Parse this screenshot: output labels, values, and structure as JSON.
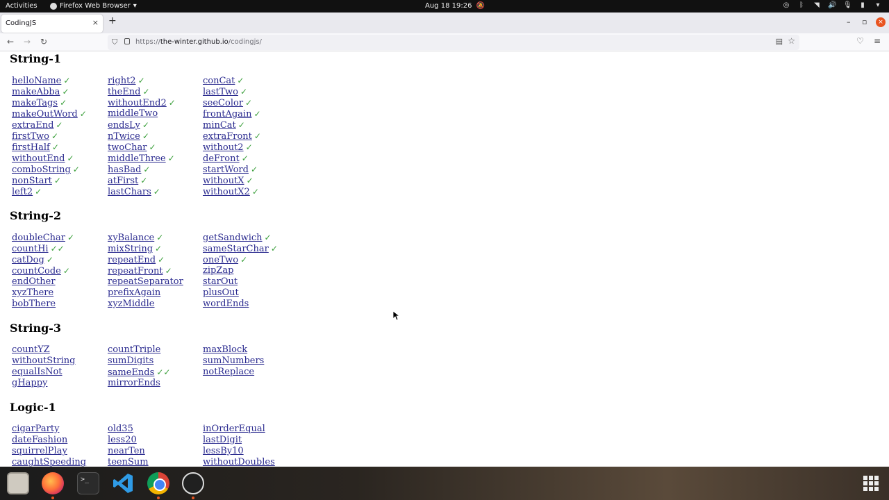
{
  "topbar": {
    "activities": "Activities",
    "app_name": "Firefox Web Browser",
    "clock": "Aug 18  19:26"
  },
  "browser": {
    "tab_title": "CodingJS",
    "url_host_prefix": "https://",
    "url_host": "the-winter.github.io",
    "url_path": "/codingjs/"
  },
  "sections": [
    {
      "title": "String-1",
      "columns": [
        [
          {
            "name": "helloName",
            "check": "✓"
          },
          {
            "name": "makeAbba",
            "check": "✓"
          },
          {
            "name": "makeTags",
            "check": "✓"
          },
          {
            "name": "makeOutWord",
            "check": "✓"
          },
          {
            "name": "extraEnd",
            "check": "✓"
          },
          {
            "name": "firstTwo",
            "check": "✓"
          },
          {
            "name": "firstHalf",
            "check": "✓"
          },
          {
            "name": "withoutEnd",
            "check": "✓"
          },
          {
            "name": "comboString",
            "check": "✓"
          },
          {
            "name": "nonStart",
            "check": "✓"
          },
          {
            "name": "left2",
            "check": "✓"
          }
        ],
        [
          {
            "name": "right2",
            "check": "✓"
          },
          {
            "name": "theEnd",
            "check": "✓"
          },
          {
            "name": "withoutEnd2",
            "check": "✓"
          },
          {
            "name": "middleTwo",
            "check": ""
          },
          {
            "name": "endsLy",
            "check": "✓"
          },
          {
            "name": "nTwice",
            "check": "✓"
          },
          {
            "name": "twoChar",
            "check": "✓"
          },
          {
            "name": "middleThree",
            "check": "✓"
          },
          {
            "name": "hasBad",
            "check": "✓"
          },
          {
            "name": "atFirst",
            "check": "✓"
          },
          {
            "name": "lastChars",
            "check": "✓"
          }
        ],
        [
          {
            "name": "conCat",
            "check": "✓"
          },
          {
            "name": "lastTwo",
            "check": "✓"
          },
          {
            "name": "seeColor",
            "check": "✓"
          },
          {
            "name": "frontAgain",
            "check": "✓"
          },
          {
            "name": "minCat",
            "check": "✓"
          },
          {
            "name": "extraFront",
            "check": "✓"
          },
          {
            "name": "without2",
            "check": "✓"
          },
          {
            "name": "deFront",
            "check": "✓"
          },
          {
            "name": "startWord",
            "check": "✓"
          },
          {
            "name": "withoutX",
            "check": "✓"
          },
          {
            "name": "withoutX2",
            "check": "✓"
          }
        ]
      ]
    },
    {
      "title": "String-2",
      "columns": [
        [
          {
            "name": "doubleChar",
            "check": "✓"
          },
          {
            "name": "countHi",
            "check": "✓✓"
          },
          {
            "name": "catDog",
            "check": "✓"
          },
          {
            "name": "countCode",
            "check": "✓"
          },
          {
            "name": "endOther",
            "check": ""
          },
          {
            "name": "xyzThere",
            "check": ""
          },
          {
            "name": "bobThere",
            "check": ""
          }
        ],
        [
          {
            "name": "xyBalance",
            "check": "✓"
          },
          {
            "name": "mixString",
            "check": "✓"
          },
          {
            "name": "repeatEnd",
            "check": "✓"
          },
          {
            "name": "repeatFront",
            "check": "✓"
          },
          {
            "name": "repeatSeparator",
            "check": ""
          },
          {
            "name": "prefixAgain",
            "check": ""
          },
          {
            "name": "xyzMiddle",
            "check": ""
          }
        ],
        [
          {
            "name": "getSandwich",
            "check": "✓"
          },
          {
            "name": "sameStarChar",
            "check": "✓"
          },
          {
            "name": "oneTwo",
            "check": "✓"
          },
          {
            "name": "zipZap",
            "check": ""
          },
          {
            "name": "starOut",
            "check": ""
          },
          {
            "name": "plusOut",
            "check": ""
          },
          {
            "name": "wordEnds",
            "check": ""
          }
        ]
      ]
    },
    {
      "title": "String-3",
      "columns": [
        [
          {
            "name": "countYZ",
            "check": ""
          },
          {
            "name": "withoutString",
            "check": ""
          },
          {
            "name": "equalIsNot",
            "check": ""
          },
          {
            "name": "gHappy",
            "check": ""
          }
        ],
        [
          {
            "name": "countTriple",
            "check": ""
          },
          {
            "name": "sumDigits",
            "check": ""
          },
          {
            "name": "sameEnds",
            "check": "✓✓"
          },
          {
            "name": "mirrorEnds",
            "check": ""
          }
        ],
        [
          {
            "name": "maxBlock",
            "check": ""
          },
          {
            "name": "sumNumbers",
            "check": ""
          },
          {
            "name": "notReplace",
            "check": ""
          }
        ]
      ]
    },
    {
      "title": "Logic-1",
      "columns": [
        [
          {
            "name": "cigarParty",
            "check": ""
          },
          {
            "name": "dateFashion",
            "check": ""
          },
          {
            "name": "squirrelPlay",
            "check": ""
          },
          {
            "name": "caughtSpeeding",
            "check": ""
          }
        ],
        [
          {
            "name": "old35",
            "check": ""
          },
          {
            "name": "less20",
            "check": ""
          },
          {
            "name": "nearTen",
            "check": ""
          },
          {
            "name": "teenSum",
            "check": ""
          }
        ],
        [
          {
            "name": "inOrderEqual",
            "check": ""
          },
          {
            "name": "lastDigit",
            "check": ""
          },
          {
            "name": "lessBy10",
            "check": ""
          },
          {
            "name": "withoutDoubles",
            "check": ""
          }
        ]
      ]
    }
  ],
  "colors": {
    "link": "#2a2a8f",
    "check": "#3da03d",
    "accent": "#e95420"
  }
}
